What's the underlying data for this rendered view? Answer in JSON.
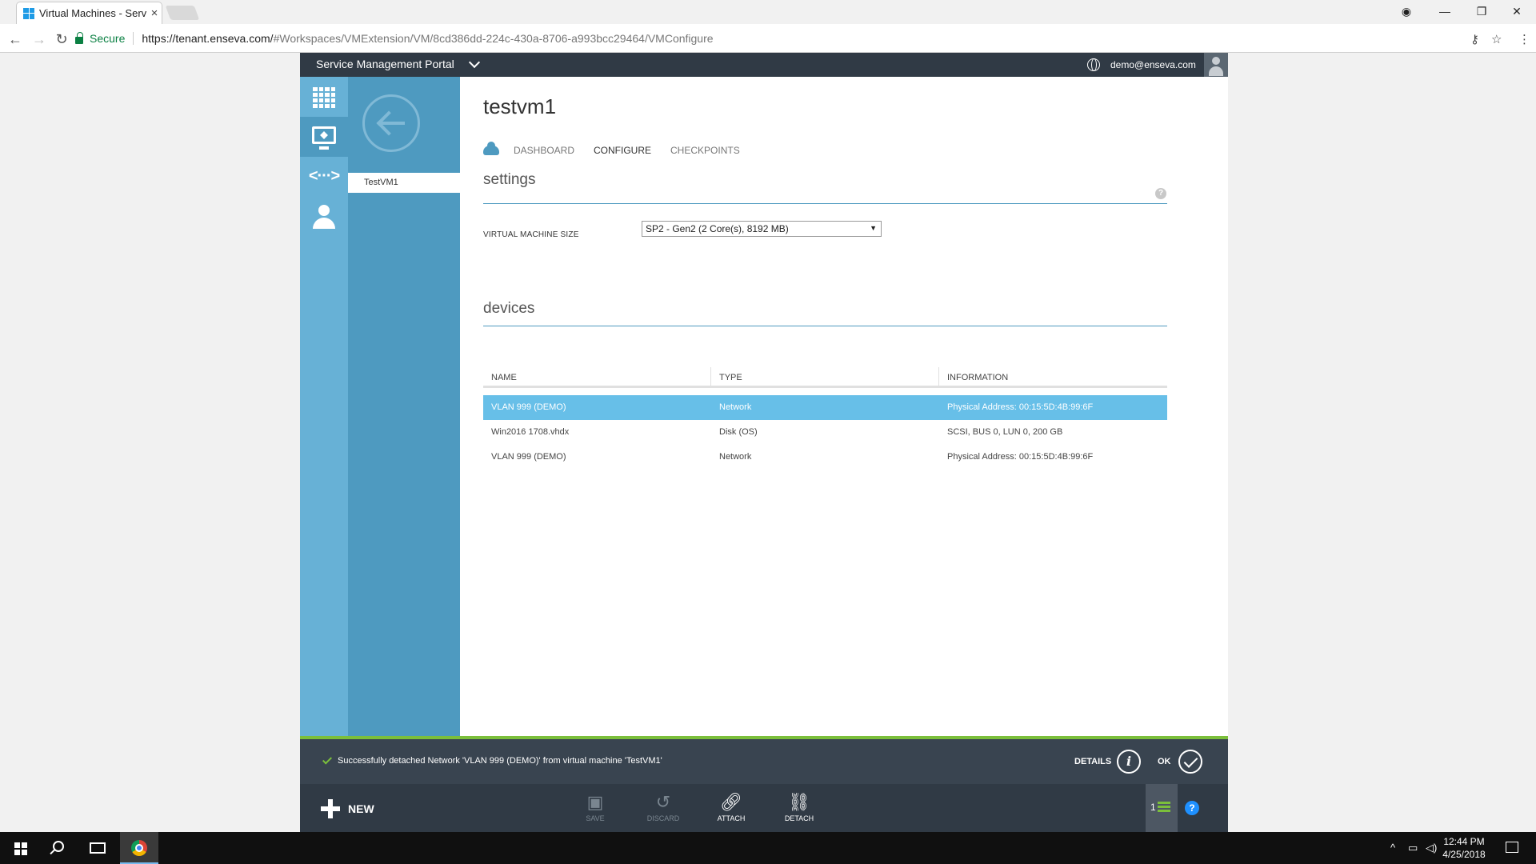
{
  "browser": {
    "tab_title": "Virtual Machines - Servic",
    "tab_close": "×",
    "secure_label": "Secure",
    "url_base": "https://tenant.enseva.com/",
    "url_rest": "#Workspaces/VMExtension/VM/8cd386dd-224c-430a-8706-a993bcc29464/VMConfigure",
    "window_buttons": {
      "minimize": "—",
      "restore": "❐",
      "close": "✕"
    }
  },
  "header": {
    "brand": "Service Management Portal",
    "user_email": "demo@enseva.com"
  },
  "leftbar": {
    "network_glyph": "<···>"
  },
  "vm_list": {
    "selected": "TestVM1"
  },
  "vm": {
    "name": "testvm1",
    "tabs": [
      "DASHBOARD",
      "CONFIGURE",
      "CHECKPOINTS"
    ],
    "active_tab": "CONFIGURE"
  },
  "settings": {
    "title": "settings",
    "help": "?",
    "size_label": "VIRTUAL MACHINE SIZE",
    "size_value": "SP2 - Gen2 (2 Core(s), 8192 MB)"
  },
  "devices": {
    "title": "devices",
    "columns": [
      "NAME",
      "TYPE",
      "INFORMATION"
    ],
    "rows": [
      {
        "name": "VLAN 999 (DEMO)",
        "type": "Network",
        "info": "Physical Address: 00:15:5D:4B:99:6F",
        "selected": true
      },
      {
        "name": "Win2016 1708.vhdx",
        "type": "Disk (OS)",
        "info": "SCSI, BUS 0, LUN 0, 200 GB",
        "selected": false
      },
      {
        "name": "VLAN 999 (DEMO)",
        "type": "Network",
        "info": "Physical Address: 00:15:5D:4B:99:6F",
        "selected": false
      }
    ]
  },
  "notification": {
    "message": "Successfully detached Network 'VLAN 999 (DEMO)' from virtual machine 'TestVM1'",
    "details_label": "DETAILS",
    "details_glyph": "i",
    "ok_label": "OK"
  },
  "commands": {
    "new_label": "NEW",
    "save": "SAVE",
    "discard": "DISCARD",
    "attach": "ATTACH",
    "detach": "DETACH",
    "notification_count": "1",
    "help": "?"
  },
  "taskbar": {
    "time": "12:44 PM",
    "date": "4/25/2018"
  },
  "colors": {
    "header_bg": "#303a45",
    "leftbar_bg": "#67b1d6",
    "panel_bg": "#4e9ac0",
    "selected_row": "#67bfe8",
    "success_green": "#7bbf3b"
  }
}
